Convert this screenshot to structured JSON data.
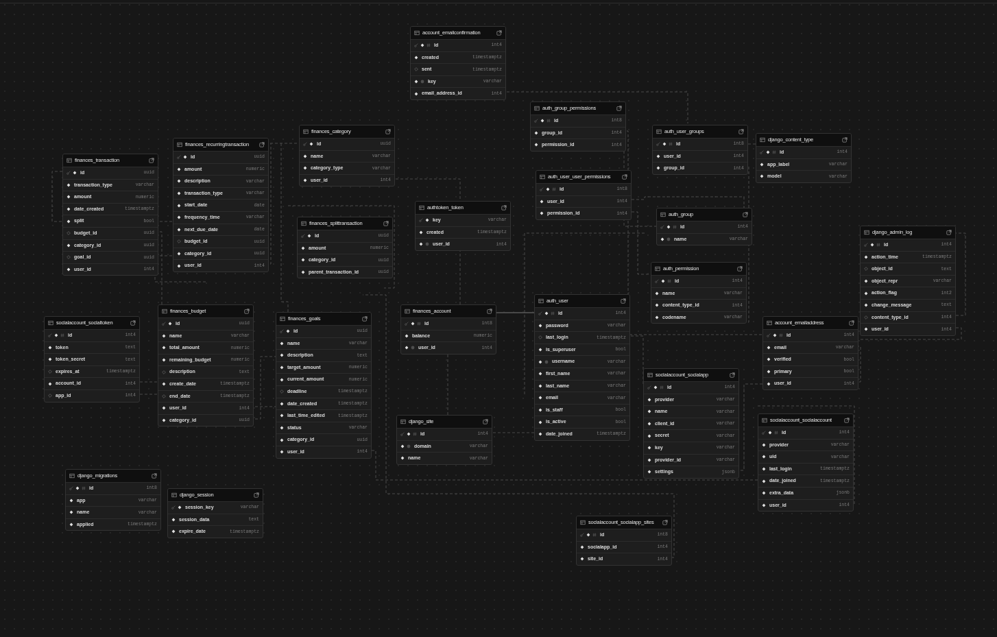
{
  "tables": [
    {
      "name": "account_emailconfirmation",
      "columns": [
        {
          "name": "id",
          "type": "int4",
          "primary_key": true,
          "nullable": false,
          "identity": true,
          "unique": false
        },
        {
          "name": "created",
          "type": "timestamptz",
          "primary_key": false,
          "nullable": false,
          "identity": false,
          "unique": false
        },
        {
          "name": "sent",
          "type": "timestamptz",
          "primary_key": false,
          "nullable": true,
          "identity": false,
          "unique": false
        },
        {
          "name": "key",
          "type": "varchar",
          "primary_key": false,
          "nullable": false,
          "identity": false,
          "unique": true
        },
        {
          "name": "email_address_id",
          "type": "int4",
          "primary_key": false,
          "nullable": false,
          "identity": false,
          "unique": false
        }
      ]
    },
    {
      "name": "auth_group_permissions",
      "columns": [
        {
          "name": "id",
          "type": "int8",
          "primary_key": true,
          "nullable": false,
          "identity": true,
          "unique": false
        },
        {
          "name": "group_id",
          "type": "int4",
          "primary_key": false,
          "nullable": false,
          "identity": false,
          "unique": false
        },
        {
          "name": "permission_id",
          "type": "int4",
          "primary_key": false,
          "nullable": false,
          "identity": false,
          "unique": false
        }
      ]
    },
    {
      "name": "finances_category",
      "columns": [
        {
          "name": "id",
          "type": "uuid",
          "primary_key": true,
          "nullable": false,
          "identity": false,
          "unique": false
        },
        {
          "name": "name",
          "type": "varchar",
          "primary_key": false,
          "nullable": false,
          "identity": false,
          "unique": false
        },
        {
          "name": "category_type",
          "type": "varchar",
          "primary_key": false,
          "nullable": false,
          "identity": false,
          "unique": false
        },
        {
          "name": "user_id",
          "type": "int4",
          "primary_key": false,
          "nullable": false,
          "identity": false,
          "unique": false
        }
      ]
    },
    {
      "name": "auth_user_groups",
      "columns": [
        {
          "name": "id",
          "type": "int8",
          "primary_key": true,
          "nullable": false,
          "identity": true,
          "unique": false
        },
        {
          "name": "user_id",
          "type": "int4",
          "primary_key": false,
          "nullable": false,
          "identity": false,
          "unique": false
        },
        {
          "name": "group_id",
          "type": "int4",
          "primary_key": false,
          "nullable": false,
          "identity": false,
          "unique": false
        }
      ]
    },
    {
      "name": "django_content_type",
      "columns": [
        {
          "name": "id",
          "type": "int4",
          "primary_key": true,
          "nullable": false,
          "identity": true,
          "unique": false
        },
        {
          "name": "app_label",
          "type": "varchar",
          "primary_key": false,
          "nullable": false,
          "identity": false,
          "unique": false
        },
        {
          "name": "model",
          "type": "varchar",
          "primary_key": false,
          "nullable": false,
          "identity": false,
          "unique": false
        }
      ]
    },
    {
      "name": "finances_recurringtransaction",
      "columns": [
        {
          "name": "id",
          "type": "uuid",
          "primary_key": true,
          "nullable": false,
          "identity": false,
          "unique": false
        },
        {
          "name": "amount",
          "type": "numeric",
          "primary_key": false,
          "nullable": false,
          "identity": false,
          "unique": false
        },
        {
          "name": "description",
          "type": "varchar",
          "primary_key": false,
          "nullable": false,
          "identity": false,
          "unique": false
        },
        {
          "name": "transaction_type",
          "type": "varchar",
          "primary_key": false,
          "nullable": false,
          "identity": false,
          "unique": false
        },
        {
          "name": "start_date",
          "type": "date",
          "primary_key": false,
          "nullable": false,
          "identity": false,
          "unique": false
        },
        {
          "name": "frequency_time",
          "type": "varchar",
          "primary_key": false,
          "nullable": false,
          "identity": false,
          "unique": false
        },
        {
          "name": "next_due_date",
          "type": "date",
          "primary_key": false,
          "nullable": false,
          "identity": false,
          "unique": false
        },
        {
          "name": "budget_id",
          "type": "uuid",
          "primary_key": false,
          "nullable": true,
          "identity": false,
          "unique": false
        },
        {
          "name": "category_id",
          "type": "uuid",
          "primary_key": false,
          "nullable": false,
          "identity": false,
          "unique": false
        },
        {
          "name": "user_id",
          "type": "int4",
          "primary_key": false,
          "nullable": false,
          "identity": false,
          "unique": false
        }
      ]
    },
    {
      "name": "finances_transaction",
      "columns": [
        {
          "name": "id",
          "type": "uuid",
          "primary_key": true,
          "nullable": false,
          "identity": false,
          "unique": false
        },
        {
          "name": "transaction_type",
          "type": "varchar",
          "primary_key": false,
          "nullable": false,
          "identity": false,
          "unique": false
        },
        {
          "name": "amount",
          "type": "numeric",
          "primary_key": false,
          "nullable": false,
          "identity": false,
          "unique": false
        },
        {
          "name": "date_created",
          "type": "timestamptz",
          "primary_key": false,
          "nullable": false,
          "identity": false,
          "unique": false
        },
        {
          "name": "split",
          "type": "bool",
          "primary_key": false,
          "nullable": false,
          "identity": false,
          "unique": false
        },
        {
          "name": "budget_id",
          "type": "uuid",
          "primary_key": false,
          "nullable": true,
          "identity": false,
          "unique": false
        },
        {
          "name": "category_id",
          "type": "uuid",
          "primary_key": false,
          "nullable": false,
          "identity": false,
          "unique": false
        },
        {
          "name": "goal_id",
          "type": "uuid",
          "primary_key": false,
          "nullable": true,
          "identity": false,
          "unique": false
        },
        {
          "name": "user_id",
          "type": "int4",
          "primary_key": false,
          "nullable": false,
          "identity": false,
          "unique": false
        }
      ]
    },
    {
      "name": "auth_user_user_permissions",
      "columns": [
        {
          "name": "id",
          "type": "int8",
          "primary_key": true,
          "nullable": false,
          "identity": true,
          "unique": false
        },
        {
          "name": "user_id",
          "type": "int4",
          "primary_key": false,
          "nullable": false,
          "identity": false,
          "unique": false
        },
        {
          "name": "permission_id",
          "type": "int4",
          "primary_key": false,
          "nullable": false,
          "identity": false,
          "unique": false
        }
      ]
    },
    {
      "name": "authtoken_token",
      "columns": [
        {
          "name": "key",
          "type": "varchar",
          "primary_key": true,
          "nullable": false,
          "identity": false,
          "unique": false
        },
        {
          "name": "created",
          "type": "timestamptz",
          "primary_key": false,
          "nullable": false,
          "identity": false,
          "unique": false
        },
        {
          "name": "user_id",
          "type": "int4",
          "primary_key": false,
          "nullable": false,
          "identity": false,
          "unique": true
        }
      ]
    },
    {
      "name": "auth_group",
      "columns": [
        {
          "name": "id",
          "type": "int4",
          "primary_key": true,
          "nullable": false,
          "identity": true,
          "unique": false
        },
        {
          "name": "name",
          "type": "varchar",
          "primary_key": false,
          "nullable": false,
          "identity": false,
          "unique": true
        }
      ]
    },
    {
      "name": "finances_splittransaction",
      "columns": [
        {
          "name": "id",
          "type": "uuid",
          "primary_key": true,
          "nullable": false,
          "identity": false,
          "unique": false
        },
        {
          "name": "amount",
          "type": "numeric",
          "primary_key": false,
          "nullable": false,
          "identity": false,
          "unique": false
        },
        {
          "name": "category_id",
          "type": "uuid",
          "primary_key": false,
          "nullable": false,
          "identity": false,
          "unique": false
        },
        {
          "name": "parent_transaction_id",
          "type": "uuid",
          "primary_key": false,
          "nullable": false,
          "identity": false,
          "unique": false
        }
      ]
    },
    {
      "name": "django_admin_log",
      "columns": [
        {
          "name": "id",
          "type": "int4",
          "primary_key": true,
          "nullable": false,
          "identity": true,
          "unique": false
        },
        {
          "name": "action_time",
          "type": "timestamptz",
          "primary_key": false,
          "nullable": false,
          "identity": false,
          "unique": false
        },
        {
          "name": "object_id",
          "type": "text",
          "primary_key": false,
          "nullable": true,
          "identity": false,
          "unique": false
        },
        {
          "name": "object_repr",
          "type": "varchar",
          "primary_key": false,
          "nullable": false,
          "identity": false,
          "unique": false
        },
        {
          "name": "action_flag",
          "type": "int2",
          "primary_key": false,
          "nullable": false,
          "identity": false,
          "unique": false
        },
        {
          "name": "change_message",
          "type": "text",
          "primary_key": false,
          "nullable": false,
          "identity": false,
          "unique": false
        },
        {
          "name": "content_type_id",
          "type": "int4",
          "primary_key": false,
          "nullable": true,
          "identity": false,
          "unique": false
        },
        {
          "name": "user_id",
          "type": "int4",
          "primary_key": false,
          "nullable": false,
          "identity": false,
          "unique": false
        }
      ]
    },
    {
      "name": "auth_permission",
      "columns": [
        {
          "name": "id",
          "type": "int4",
          "primary_key": true,
          "nullable": false,
          "identity": true,
          "unique": false
        },
        {
          "name": "name",
          "type": "varchar",
          "primary_key": false,
          "nullable": false,
          "identity": false,
          "unique": false
        },
        {
          "name": "content_type_id",
          "type": "int4",
          "primary_key": false,
          "nullable": false,
          "identity": false,
          "unique": false
        },
        {
          "name": "codename",
          "type": "varchar",
          "primary_key": false,
          "nullable": false,
          "identity": false,
          "unique": false
        }
      ]
    },
    {
      "name": "socialaccount_socialtoken",
      "columns": [
        {
          "name": "id",
          "type": "int4",
          "primary_key": true,
          "nullable": false,
          "identity": true,
          "unique": false
        },
        {
          "name": "token",
          "type": "text",
          "primary_key": false,
          "nullable": false,
          "identity": false,
          "unique": false
        },
        {
          "name": "token_secret",
          "type": "text",
          "primary_key": false,
          "nullable": false,
          "identity": false,
          "unique": false
        },
        {
          "name": "expires_at",
          "type": "timestamptz",
          "primary_key": false,
          "nullable": true,
          "identity": false,
          "unique": false
        },
        {
          "name": "account_id",
          "type": "int4",
          "primary_key": false,
          "nullable": false,
          "identity": false,
          "unique": false
        },
        {
          "name": "app_id",
          "type": "int4",
          "primary_key": false,
          "nullable": true,
          "identity": false,
          "unique": false
        }
      ]
    },
    {
      "name": "finances_budget",
      "columns": [
        {
          "name": "id",
          "type": "uuid",
          "primary_key": true,
          "nullable": false,
          "identity": false,
          "unique": false
        },
        {
          "name": "name",
          "type": "varchar",
          "primary_key": false,
          "nullable": false,
          "identity": false,
          "unique": false
        },
        {
          "name": "total_amount",
          "type": "numeric",
          "primary_key": false,
          "nullable": false,
          "identity": false,
          "unique": false
        },
        {
          "name": "remaining_budget",
          "type": "numeric",
          "primary_key": false,
          "nullable": false,
          "identity": false,
          "unique": false
        },
        {
          "name": "description",
          "type": "text",
          "primary_key": false,
          "nullable": true,
          "identity": false,
          "unique": false
        },
        {
          "name": "create_date",
          "type": "timestamptz",
          "primary_key": false,
          "nullable": false,
          "identity": false,
          "unique": false
        },
        {
          "name": "end_date",
          "type": "timestamptz",
          "primary_key": false,
          "nullable": true,
          "identity": false,
          "unique": false
        },
        {
          "name": "user_id",
          "type": "int4",
          "primary_key": false,
          "nullable": false,
          "identity": false,
          "unique": false
        },
        {
          "name": "category_id",
          "type": "uuid",
          "primary_key": false,
          "nullable": false,
          "identity": false,
          "unique": false
        }
      ]
    },
    {
      "name": "finances_goals",
      "columns": [
        {
          "name": "id",
          "type": "uuid",
          "primary_key": true,
          "nullable": false,
          "identity": false,
          "unique": false
        },
        {
          "name": "name",
          "type": "varchar",
          "primary_key": false,
          "nullable": false,
          "identity": false,
          "unique": false
        },
        {
          "name": "description",
          "type": "text",
          "primary_key": false,
          "nullable": false,
          "identity": false,
          "unique": false
        },
        {
          "name": "target_amount",
          "type": "numeric",
          "primary_key": false,
          "nullable": false,
          "identity": false,
          "unique": false
        },
        {
          "name": "current_amount",
          "type": "numeric",
          "primary_key": false,
          "nullable": false,
          "identity": false,
          "unique": false
        },
        {
          "name": "deadline",
          "type": "timestamptz",
          "primary_key": false,
          "nullable": true,
          "identity": false,
          "unique": false
        },
        {
          "name": "date_created",
          "type": "timestamptz",
          "primary_key": false,
          "nullable": false,
          "identity": false,
          "unique": false
        },
        {
          "name": "last_time_edited",
          "type": "timestamptz",
          "primary_key": false,
          "nullable": false,
          "identity": false,
          "unique": false
        },
        {
          "name": "status",
          "type": "varchar",
          "primary_key": false,
          "nullable": false,
          "identity": false,
          "unique": false
        },
        {
          "name": "category_id",
          "type": "uuid",
          "primary_key": false,
          "nullable": false,
          "identity": false,
          "unique": false
        },
        {
          "name": "user_id",
          "type": "int4",
          "primary_key": false,
          "nullable": false,
          "identity": false,
          "unique": false
        }
      ]
    },
    {
      "name": "finances_account",
      "columns": [
        {
          "name": "id",
          "type": "int8",
          "primary_key": true,
          "nullable": false,
          "identity": true,
          "unique": false
        },
        {
          "name": "balance",
          "type": "numeric",
          "primary_key": false,
          "nullable": false,
          "identity": false,
          "unique": false
        },
        {
          "name": "user_id",
          "type": "int4",
          "primary_key": false,
          "nullable": false,
          "identity": false,
          "unique": true
        }
      ]
    },
    {
      "name": "django_site",
      "columns": [
        {
          "name": "id",
          "type": "int4",
          "primary_key": true,
          "nullable": false,
          "identity": true,
          "unique": false
        },
        {
          "name": "domain",
          "type": "varchar",
          "primary_key": false,
          "nullable": false,
          "identity": false,
          "unique": true
        },
        {
          "name": "name",
          "type": "varchar",
          "primary_key": false,
          "nullable": false,
          "identity": false,
          "unique": false
        }
      ]
    },
    {
      "name": "auth_user",
      "columns": [
        {
          "name": "id",
          "type": "int4",
          "primary_key": true,
          "nullable": false,
          "identity": true,
          "unique": false
        },
        {
          "name": "password",
          "type": "varchar",
          "primary_key": false,
          "nullable": false,
          "identity": false,
          "unique": false
        },
        {
          "name": "last_login",
          "type": "timestamptz",
          "primary_key": false,
          "nullable": true,
          "identity": false,
          "unique": false
        },
        {
          "name": "is_superuser",
          "type": "bool",
          "primary_key": false,
          "nullable": false,
          "identity": false,
          "unique": false
        },
        {
          "name": "username",
          "type": "varchar",
          "primary_key": false,
          "nullable": false,
          "identity": false,
          "unique": true
        },
        {
          "name": "first_name",
          "type": "varchar",
          "primary_key": false,
          "nullable": false,
          "identity": false,
          "unique": false
        },
        {
          "name": "last_name",
          "type": "varchar",
          "primary_key": false,
          "nullable": false,
          "identity": false,
          "unique": false
        },
        {
          "name": "email",
          "type": "varchar",
          "primary_key": false,
          "nullable": false,
          "identity": false,
          "unique": false
        },
        {
          "name": "is_staff",
          "type": "bool",
          "primary_key": false,
          "nullable": false,
          "identity": false,
          "unique": false
        },
        {
          "name": "is_active",
          "type": "bool",
          "primary_key": false,
          "nullable": false,
          "identity": false,
          "unique": false
        },
        {
          "name": "date_joined",
          "type": "timestamptz",
          "primary_key": false,
          "nullable": false,
          "identity": false,
          "unique": false
        }
      ]
    },
    {
      "name": "account_emailaddress",
      "columns": [
        {
          "name": "id",
          "type": "int4",
          "primary_key": true,
          "nullable": false,
          "identity": true,
          "unique": false
        },
        {
          "name": "email",
          "type": "varchar",
          "primary_key": false,
          "nullable": false,
          "identity": false,
          "unique": false
        },
        {
          "name": "verified",
          "type": "bool",
          "primary_key": false,
          "nullable": false,
          "identity": false,
          "unique": false
        },
        {
          "name": "primary",
          "type": "bool",
          "primary_key": false,
          "nullable": false,
          "identity": false,
          "unique": false
        },
        {
          "name": "user_id",
          "type": "int4",
          "primary_key": false,
          "nullable": false,
          "identity": false,
          "unique": false
        }
      ]
    },
    {
      "name": "socialaccount_socialapp",
      "columns": [
        {
          "name": "id",
          "type": "int4",
          "primary_key": true,
          "nullable": false,
          "identity": true,
          "unique": false
        },
        {
          "name": "provider",
          "type": "varchar",
          "primary_key": false,
          "nullable": false,
          "identity": false,
          "unique": false
        },
        {
          "name": "name",
          "type": "varchar",
          "primary_key": false,
          "nullable": false,
          "identity": false,
          "unique": false
        },
        {
          "name": "client_id",
          "type": "varchar",
          "primary_key": false,
          "nullable": false,
          "identity": false,
          "unique": false
        },
        {
          "name": "secret",
          "type": "varchar",
          "primary_key": false,
          "nullable": false,
          "identity": false,
          "unique": false
        },
        {
          "name": "key",
          "type": "varchar",
          "primary_key": false,
          "nullable": false,
          "identity": false,
          "unique": false
        },
        {
          "name": "provider_id",
          "type": "varchar",
          "primary_key": false,
          "nullable": false,
          "identity": false,
          "unique": false
        },
        {
          "name": "settings",
          "type": "jsonb",
          "primary_key": false,
          "nullable": false,
          "identity": false,
          "unique": false
        }
      ]
    },
    {
      "name": "socialaccount_socialaccount",
      "columns": [
        {
          "name": "id",
          "type": "int4",
          "primary_key": true,
          "nullable": false,
          "identity": true,
          "unique": false
        },
        {
          "name": "provider",
          "type": "varchar",
          "primary_key": false,
          "nullable": false,
          "identity": false,
          "unique": false
        },
        {
          "name": "uid",
          "type": "varchar",
          "primary_key": false,
          "nullable": false,
          "identity": false,
          "unique": false
        },
        {
          "name": "last_login",
          "type": "timestamptz",
          "primary_key": false,
          "nullable": false,
          "identity": false,
          "unique": false
        },
        {
          "name": "date_joined",
          "type": "timestamptz",
          "primary_key": false,
          "nullable": false,
          "identity": false,
          "unique": false
        },
        {
          "name": "extra_data",
          "type": "jsonb",
          "primary_key": false,
          "nullable": false,
          "identity": false,
          "unique": false
        },
        {
          "name": "user_id",
          "type": "int4",
          "primary_key": false,
          "nullable": false,
          "identity": false,
          "unique": false
        }
      ]
    },
    {
      "name": "django_migrations",
      "columns": [
        {
          "name": "id",
          "type": "int8",
          "primary_key": true,
          "nullable": false,
          "identity": true,
          "unique": false
        },
        {
          "name": "app",
          "type": "varchar",
          "primary_key": false,
          "nullable": false,
          "identity": false,
          "unique": false
        },
        {
          "name": "name",
          "type": "varchar",
          "primary_key": false,
          "nullable": false,
          "identity": false,
          "unique": false
        },
        {
          "name": "applied",
          "type": "timestamptz",
          "primary_key": false,
          "nullable": false,
          "identity": false,
          "unique": false
        }
      ]
    },
    {
      "name": "django_session",
      "columns": [
        {
          "name": "session_key",
          "type": "varchar",
          "primary_key": true,
          "nullable": false,
          "identity": false,
          "unique": false
        },
        {
          "name": "session_data",
          "type": "text",
          "primary_key": false,
          "nullable": false,
          "identity": false,
          "unique": false
        },
        {
          "name": "expire_date",
          "type": "timestamptz",
          "primary_key": false,
          "nullable": false,
          "identity": false,
          "unique": false
        }
      ]
    },
    {
      "name": "socialaccount_socialapp_sites",
      "columns": [
        {
          "name": "id",
          "type": "int8",
          "primary_key": true,
          "nullable": false,
          "identity": true,
          "unique": false
        },
        {
          "name": "socialapp_id",
          "type": "int4",
          "primary_key": false,
          "nullable": false,
          "identity": false,
          "unique": false
        },
        {
          "name": "site_id",
          "type": "int4",
          "primary_key": false,
          "nullable": false,
          "identity": false,
          "unique": false
        }
      ]
    }
  ]
}
